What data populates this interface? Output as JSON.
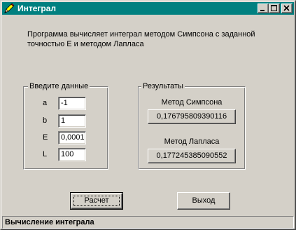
{
  "window": {
    "title": "Интеграл",
    "title_bar_color": "#008080",
    "icon": "pencil-icon"
  },
  "title_buttons": {
    "minimize_icon": "minimize-icon",
    "maximize_icon": "maximize-icon",
    "close_icon": "close-icon"
  },
  "description": {
    "line1": "Программа вычисляет интеграл методом Симпсона с заданной",
    "line2": "точностью Е и  методом Лапласа"
  },
  "input_group": {
    "title": "Введите данные",
    "fields": [
      {
        "label": "a",
        "value": "-1"
      },
      {
        "label": "b",
        "value": "1"
      },
      {
        "label": "E",
        "value": "0,0001"
      },
      {
        "label": "L",
        "value": "100"
      }
    ]
  },
  "results_group": {
    "title": "Результаты",
    "simpson_label": "Метод Симпсона",
    "simpson_value": "0,176795809390116",
    "laplace_label": "Метод Лапласа",
    "laplace_value": "0,177245385090552"
  },
  "buttons": {
    "calculate": "Расчет",
    "exit": "Выход"
  },
  "statusbar": {
    "text": "Вычисление интеграла"
  }
}
